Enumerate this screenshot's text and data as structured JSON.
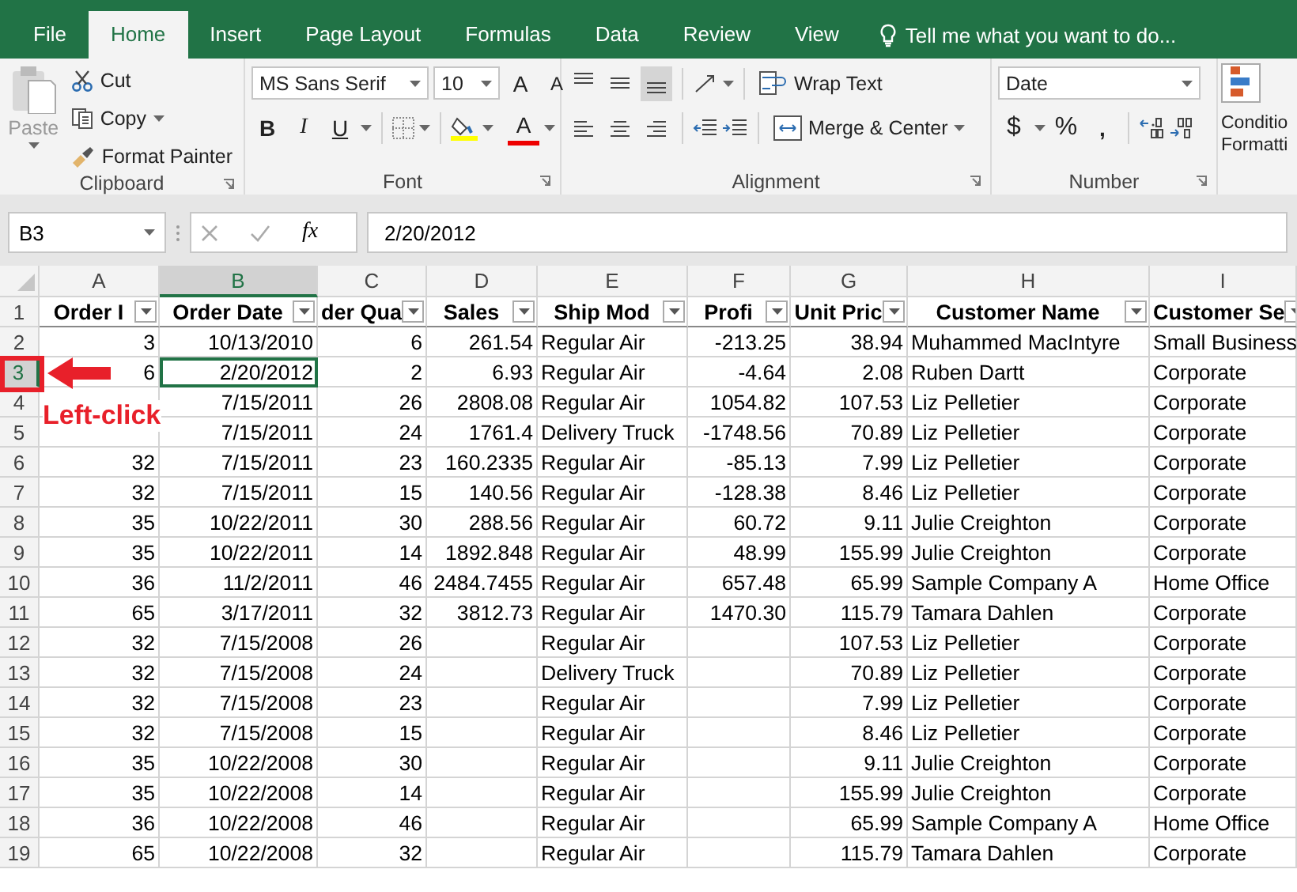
{
  "tabs": [
    {
      "label": "File",
      "selected": false
    },
    {
      "label": "Home",
      "selected": true
    },
    {
      "label": "Insert",
      "selected": false
    },
    {
      "label": "Page Layout",
      "selected": false
    },
    {
      "label": "Formulas",
      "selected": false
    },
    {
      "label": "Data",
      "selected": false
    },
    {
      "label": "Review",
      "selected": false
    },
    {
      "label": "View",
      "selected": false
    }
  ],
  "tell_me": "Tell me what you want to do...",
  "clipboard": {
    "label": "Clipboard",
    "paste": "Paste",
    "paste_disabled": true,
    "cut": "Cut",
    "copy": "Copy",
    "format_painter": "Format Painter"
  },
  "font": {
    "label": "Font",
    "name": "MS Sans Serif",
    "size": "10",
    "grow": "A",
    "shrink": "A",
    "bold": "B",
    "italic": "I",
    "underline": "U",
    "color_letter": "A"
  },
  "alignment": {
    "label": "Alignment",
    "vertical": [
      {
        "selected": false
      },
      {
        "selected": false
      },
      {
        "selected": true
      }
    ],
    "wrap_text": "Wrap Text",
    "merge_center": "Merge & Center"
  },
  "number": {
    "label": "Number",
    "format": "Date",
    "currency": "$",
    "percent": "%",
    "comma": ","
  },
  "styles": {
    "conditional_formatting": [
      "Conditio",
      "Formatti"
    ]
  },
  "formula_bar": {
    "name_box": "B3",
    "function_label": "fx",
    "value": "2/20/2012"
  },
  "sheet": {
    "columns": [
      {
        "letter": "A",
        "header": "Order I",
        "kind": "number",
        "selected": false
      },
      {
        "letter": "B",
        "header": "Order Date",
        "kind": "number",
        "selected": true
      },
      {
        "letter": "C",
        "header": "der Qua",
        "kind": "number",
        "selected": false
      },
      {
        "letter": "D",
        "header": "Sales",
        "kind": "number",
        "selected": false
      },
      {
        "letter": "E",
        "header": "Ship Mod",
        "kind": "text",
        "selected": false
      },
      {
        "letter": "F",
        "header": "Profi",
        "kind": "number",
        "selected": false
      },
      {
        "letter": "G",
        "header": "Unit Pric",
        "kind": "number",
        "selected": false
      },
      {
        "letter": "H",
        "header": "Customer Name",
        "kind": "text",
        "selected": false
      },
      {
        "letter": "I",
        "header": "Customer Se",
        "kind": "text",
        "selected": false
      }
    ],
    "header_row": "1",
    "rows": [
      {
        "number": "2",
        "selected": false,
        "cells": [
          "3",
          "10/13/2010",
          "6",
          "261.54",
          "Regular Air",
          "-213.25",
          "38.94",
          "Muhammed MacIntyre",
          "Small Business"
        ]
      },
      {
        "number": "3",
        "selected": true,
        "cells": [
          "6",
          "2/20/2012",
          "2",
          "6.93",
          "Regular Air",
          "-4.64",
          "2.08",
          "Ruben Dartt",
          "Corporate"
        ]
      },
      {
        "number": "4",
        "selected": false,
        "cells": [
          null,
          "7/15/2011",
          "26",
          "2808.08",
          "Regular Air",
          "1054.82",
          "107.53",
          "Liz Pelletier",
          "Corporate"
        ]
      },
      {
        "number": "5",
        "selected": false,
        "cells": [
          null,
          "7/15/2011",
          "24",
          "1761.4",
          "Delivery Truck",
          "-1748.56",
          "70.89",
          "Liz Pelletier",
          "Corporate"
        ]
      },
      {
        "number": "6",
        "selected": false,
        "cells": [
          "32",
          "7/15/2011",
          "23",
          "160.2335",
          "Regular Air",
          "-85.13",
          "7.99",
          "Liz Pelletier",
          "Corporate"
        ]
      },
      {
        "number": "7",
        "selected": false,
        "cells": [
          "32",
          "7/15/2011",
          "15",
          "140.56",
          "Regular Air",
          "-128.38",
          "8.46",
          "Liz Pelletier",
          "Corporate"
        ]
      },
      {
        "number": "8",
        "selected": false,
        "cells": [
          "35",
          "10/22/2011",
          "30",
          "288.56",
          "Regular Air",
          "60.72",
          "9.11",
          "Julie Creighton",
          "Corporate"
        ]
      },
      {
        "number": "9",
        "selected": false,
        "cells": [
          "35",
          "10/22/2011",
          "14",
          "1892.848",
          "Regular Air",
          "48.99",
          "155.99",
          "Julie Creighton",
          "Corporate"
        ]
      },
      {
        "number": "10",
        "selected": false,
        "cells": [
          "36",
          "11/2/2011",
          "46",
          "2484.7455",
          "Regular Air",
          "657.48",
          "65.99",
          "Sample Company A",
          "Home Office"
        ]
      },
      {
        "number": "11",
        "selected": false,
        "cells": [
          "65",
          "3/17/2011",
          "32",
          "3812.73",
          "Regular Air",
          "1470.30",
          "115.79",
          "Tamara Dahlen",
          "Corporate"
        ]
      },
      {
        "number": "12",
        "selected": false,
        "cells": [
          "32",
          "7/15/2008",
          "26",
          null,
          "Regular Air",
          null,
          "107.53",
          "Liz Pelletier",
          "Corporate"
        ]
      },
      {
        "number": "13",
        "selected": false,
        "cells": [
          "32",
          "7/15/2008",
          "24",
          null,
          "Delivery Truck",
          null,
          "70.89",
          "Liz Pelletier",
          "Corporate"
        ]
      },
      {
        "number": "14",
        "selected": false,
        "cells": [
          "32",
          "7/15/2008",
          "23",
          null,
          "Regular Air",
          null,
          "7.99",
          "Liz Pelletier",
          "Corporate"
        ]
      },
      {
        "number": "15",
        "selected": false,
        "cells": [
          "32",
          "7/15/2008",
          "15",
          null,
          "Regular Air",
          null,
          "8.46",
          "Liz Pelletier",
          "Corporate"
        ]
      },
      {
        "number": "16",
        "selected": false,
        "cells": [
          "35",
          "10/22/2008",
          "30",
          null,
          "Regular Air",
          null,
          "9.11",
          "Julie Creighton",
          "Corporate"
        ]
      },
      {
        "number": "17",
        "selected": false,
        "cells": [
          "35",
          "10/22/2008",
          "14",
          null,
          "Regular Air",
          null,
          "155.99",
          "Julie Creighton",
          "Corporate"
        ]
      },
      {
        "number": "18",
        "selected": false,
        "cells": [
          "36",
          "10/22/2008",
          "46",
          null,
          "Regular Air",
          null,
          "65.99",
          "Sample Company A",
          "Home Office"
        ]
      },
      {
        "number": "19",
        "selected": false,
        "cells": [
          "65",
          "10/22/2008",
          "32",
          null,
          "Regular Air",
          null,
          "115.79",
          "Tamara Dahlen",
          "Corporate"
        ]
      }
    ]
  },
  "annotation": {
    "text": "Left-click"
  }
}
